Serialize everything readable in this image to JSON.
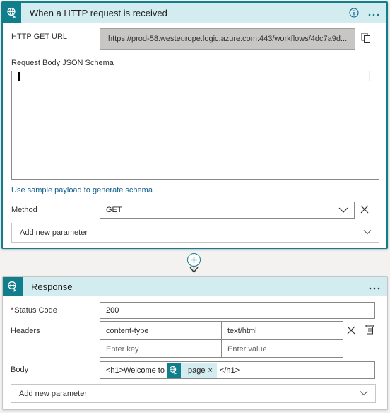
{
  "trigger": {
    "title": "When a HTTP request is received",
    "http_get_url_label": "HTTP GET URL",
    "http_get_url_value": "https://prod-58.westeurope.logic.azure.com:443/workflows/4dc7a9d...",
    "schema_label": "Request Body JSON Schema",
    "sample_payload_link": "Use sample payload to generate schema",
    "method_label": "Method",
    "method_value": "GET",
    "add_param_label": "Add new parameter"
  },
  "response": {
    "title": "Response",
    "status_code_required_mark": "*",
    "status_code_label": "Status Code",
    "status_code_value": "200",
    "headers_label": "Headers",
    "headers": [
      {
        "key": "content-type",
        "value": "text/html"
      }
    ],
    "header_key_placeholder": "Enter key",
    "header_value_placeholder": "Enter value",
    "body_label": "Body",
    "body_prefix": "<h1>Welcome to",
    "body_token": "page",
    "body_token_close": "×",
    "body_suffix": "</h1>",
    "add_param_label": "Add new parameter"
  },
  "icons": {
    "trigger_icon": "http-request-globe-icon",
    "response_icon": "http-request-globe-icon",
    "info": "info-icon",
    "more": "more-icon",
    "copy": "copy-icon",
    "chevron": "chevron-down-icon",
    "close": "close-icon",
    "delete": "delete-icon",
    "add": "add-step-icon"
  },
  "colors": {
    "accent": "#117e8b",
    "header_bg": "#d2ecef",
    "link": "#0f5e8c",
    "required": "#a4262c"
  }
}
